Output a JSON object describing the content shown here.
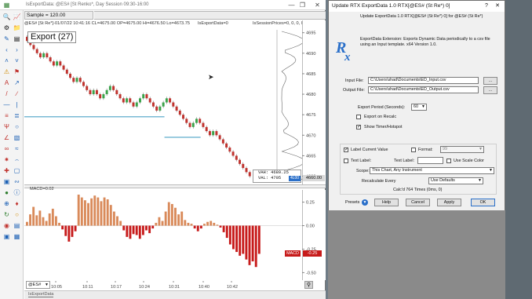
{
  "chart_window": {
    "title": "IsExportData: @ES# [St Renko*, Day Session 09:30-16:00",
    "sample_label": "Sample = 120.00",
    "info_line": "@ES# [St Re*]-01/07/22 10:41:16 CL=4675.00 OP=4675.00 Hi=4676.50 Lo=4673.75",
    "indicator_tag_1": "IsExportData=0",
    "indicator_tag_2": "IsSessionPrices=0, 0, 0, 0",
    "export_label": "Export (27)",
    "price_axis_ticks": [
      "4695",
      "4690",
      "4685",
      "4680",
      "4675",
      "4670",
      "4665",
      "4660"
    ],
    "vah_label": "VAH: 4689.25",
    "val_label": "VAL: 4705",
    "current_price": "4660.00",
    "last_badge": "4L00",
    "macd_label": "MACD=0.02",
    "macd_axis_ticks": [
      "0.25",
      "0.00",
      "-0.25",
      "-0.50"
    ],
    "macd_badge": "MACD",
    "macd_value_badge": "-0.25",
    "time_ticks": [
      "10:05",
      "10:11",
      "10:17",
      "10:24",
      "10:31",
      "10:40",
      "10:42"
    ],
    "symbol": "@ES#",
    "tab_label": "IsExportData",
    "colors": {
      "up": "#3aa34a",
      "down": "#c0332e",
      "macd_up": "#d98a5a",
      "macd_down": "#c71b1b",
      "level_line": "#4da3c7",
      "axis_badge": "#2a6fc9"
    }
  },
  "dialog": {
    "title": "Update RTX ExportData 1.0 RTX[@ES# (St Re*) 0]",
    "subtitle": "Update ExportData 1.0 RTX[@ES# (St Re*) 0] for @ES# (St Re*)",
    "description": "ExportData Extension: Exports Dynamic Data periodically to a csv file using an Input template. x64 Version 1.0.",
    "input_file_label": "Input File:",
    "input_file_value": "C:\\Users\\shad\\Documents\\ED_Input.csv",
    "output_file_label": "Output File:",
    "output_file_value": "C:\\Users\\shad\\Documents\\ED_Output.csv",
    "browse_label": "...",
    "export_period_label": "Export Period (Seconds):",
    "export_period_value": "60",
    "export_on_recalc": "Export on Recalc",
    "show_timer": "Show Timer/Hotspot",
    "label_current_value": "Label Current Value",
    "format_label": "Format:",
    "format_value": "99",
    "text_label_check": "Text Label:",
    "text_label_field": "Text Label:",
    "use_scale_color": "Use Scale Color",
    "scope_label": "Scope:",
    "scope_value": "This Chart, Any Instrument",
    "recalc_label": "Recalculate Every",
    "recalc_value": "Use Defaults",
    "calc_status": "Calc'd 764 Times (0ms, 0)",
    "presets": "Presets",
    "help": "Help",
    "cancel": "Cancel",
    "apply": "Apply",
    "ok": "OK"
  },
  "chart_data": [
    {
      "type": "bar",
      "title": "Export (27)",
      "ylim": [
        4658,
        4698
      ],
      "x": [
        "10:05",
        "10:11",
        "10:17",
        "10:24",
        "10:31",
        "10:40",
        "10:42"
      ],
      "bricks": [
        [
          4694,
          4693,
          "d"
        ],
        [
          4693,
          4692,
          "d"
        ],
        [
          4692,
          4691,
          "d"
        ],
        [
          4691,
          4690,
          "d"
        ],
        [
          4690,
          4689,
          "d"
        ],
        [
          4689,
          4690,
          "u"
        ],
        [
          4690,
          4689,
          "d"
        ],
        [
          4689,
          4688,
          "d"
        ],
        [
          4688,
          4687,
          "d"
        ],
        [
          4687,
          4688,
          "u"
        ],
        [
          4688,
          4687,
          "d"
        ],
        [
          4687,
          4686,
          "d"
        ],
        [
          4686,
          4685,
          "d"
        ],
        [
          4685,
          4684,
          "d"
        ],
        [
          4684,
          4683,
          "d"
        ],
        [
          4683,
          4684,
          "u"
        ],
        [
          4684,
          4683,
          "d"
        ],
        [
          4683,
          4682,
          "d"
        ],
        [
          4682,
          4681,
          "d"
        ],
        [
          4681,
          4680,
          "d"
        ],
        [
          4680,
          4681,
          "u"
        ],
        [
          4681,
          4680,
          "d"
        ],
        [
          4680,
          4679,
          "d"
        ],
        [
          4679,
          4680,
          "u"
        ],
        [
          4680,
          4681,
          "u"
        ],
        [
          4681,
          4682,
          "u"
        ],
        [
          4682,
          4681,
          "d"
        ],
        [
          4681,
          4680,
          "d"
        ],
        [
          4680,
          4679,
          "d"
        ],
        [
          4679,
          4678,
          "d"
        ],
        [
          4678,
          4679,
          "u"
        ],
        [
          4679,
          4678,
          "d"
        ],
        [
          4678,
          4677,
          "d"
        ],
        [
          4677,
          4678,
          "u"
        ],
        [
          4678,
          4679,
          "u"
        ],
        [
          4679,
          4680,
          "u"
        ],
        [
          4680,
          4679,
          "d"
        ],
        [
          4679,
          4678,
          "d"
        ],
        [
          4678,
          4677,
          "d"
        ],
        [
          4677,
          4676,
          "d"
        ],
        [
          4676,
          4677,
          "u"
        ],
        [
          4677,
          4678,
          "u"
        ],
        [
          4678,
          4679,
          "u"
        ],
        [
          4679,
          4678,
          "d"
        ],
        [
          4678,
          4677,
          "d"
        ],
        [
          4677,
          4676,
          "d"
        ],
        [
          4676,
          4675,
          "d"
        ],
        [
          4675,
          4674,
          "d"
        ],
        [
          4674,
          4673,
          "d"
        ],
        [
          4673,
          4672,
          "d"
        ],
        [
          4672,
          4673,
          "u"
        ],
        [
          4673,
          4674,
          "u"
        ],
        [
          4674,
          4673,
          "d"
        ],
        [
          4673,
          4672,
          "d"
        ],
        [
          4672,
          4671,
          "d"
        ],
        [
          4671,
          4670,
          "d"
        ],
        [
          4670,
          4671,
          "u"
        ],
        [
          4671,
          4670,
          "d"
        ],
        [
          4670,
          4669,
          "d"
        ],
        [
          4669,
          4668,
          "d"
        ],
        [
          4668,
          4667,
          "d"
        ],
        [
          4667,
          4666,
          "d"
        ],
        [
          4666,
          4665,
          "d"
        ],
        [
          4665,
          4664,
          "d"
        ],
        [
          4664,
          4663,
          "d"
        ],
        [
          4663,
          4662,
          "d"
        ],
        [
          4662,
          4661,
          "d"
        ],
        [
          4661,
          4660,
          "d"
        ]
      ],
      "levels": [
        {
          "value": 4674.5,
          "from_fraction": 0.0,
          "to_fraction": 0.62
        },
        {
          "value": 4669.5,
          "from_fraction": 0.62,
          "to_fraction": 0.78
        }
      ]
    },
    {
      "type": "bar",
      "title": "MACD=0.02",
      "ylim": [
        -0.58,
        0.38
      ],
      "values": [
        0.04,
        0.12,
        0.2,
        0.11,
        0.16,
        0.09,
        0.05,
        0.13,
        0.18,
        0.1,
        0.03,
        -0.04,
        -0.11,
        -0.17,
        -0.12,
        -0.06,
        0.33,
        0.3,
        0.27,
        0.24,
        0.29,
        0.32,
        0.3,
        0.26,
        0.3,
        0.28,
        0.22,
        0.15,
        0.1,
        0.05,
        -0.05,
        -0.12,
        -0.14,
        -0.09,
        -0.1,
        -0.14,
        -0.1,
        -0.05,
        -0.08,
        -0.03,
        0.03,
        0.09,
        0.05,
        0.15,
        0.25,
        0.23,
        0.19,
        0.12,
        0.15,
        0.06,
        0.03,
        0.02,
        -0.03,
        -0.06,
        -0.03,
        0.02,
        0.04,
        0.05,
        0.03,
        0.01,
        -0.02,
        -0.07,
        -0.13,
        -0.2,
        -0.25,
        -0.28,
        -0.32,
        -0.3,
        -0.36,
        -0.42,
        -0.38,
        -0.44,
        -0.3
      ]
    }
  ]
}
